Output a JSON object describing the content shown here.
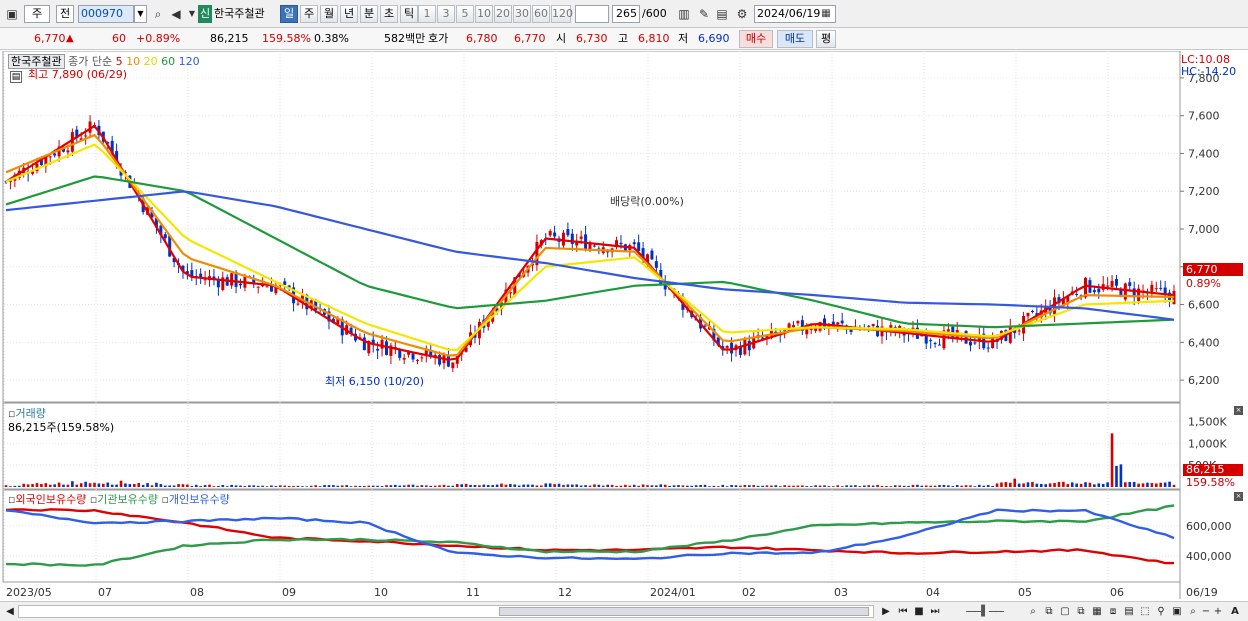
{
  "toolbar": {
    "market": "주",
    "prev_label": "전",
    "code": "000970",
    "stock_name": "한국주철관",
    "new_badge": "신",
    "periods": [
      "일",
      "주",
      "월",
      "년",
      "분",
      "초",
      "틱"
    ],
    "active_period": "일",
    "intervals": [
      "1",
      "3",
      "5",
      "10",
      "20",
      "30",
      "60",
      "120"
    ],
    "count": "265",
    "count_total": "/600",
    "date": "2024/06/19"
  },
  "quote": {
    "price": "6,770",
    "change_arrow": "▲",
    "change": "60",
    "change_pct": "+0.89%",
    "volume": "86,215",
    "volume_ratio": "159.58%",
    "turnover": "0.38%",
    "amount": "582백만",
    "bid_label": "호가",
    "ask": "6,780",
    "bid": "6,770",
    "open_label": "시",
    "open": "6,730",
    "high_label": "고",
    "high": "6,810",
    "low_label": "저",
    "low": "6,690",
    "buy_button": "매수",
    "sell_button": "매도",
    "eval_button": "평"
  },
  "price_panel": {
    "title": "한국주철관",
    "ma_label": "종가 단순",
    "ma_periods": [
      "5",
      "10",
      "20",
      "60",
      "120"
    ],
    "max_label": "최고 7,890 (06/29)",
    "min_label": "최저 6,150 (10/20)",
    "dividend_label": "배당락(0.00%)",
    "lc": "LC:10.08",
    "hc": "HC:-14.20",
    "y_ticks": [
      "7,800",
      "7,600",
      "7,400",
      "7,200",
      "7,000",
      "6,800",
      "6,600",
      "6,400",
      "6,200"
    ],
    "last_price_tag": "6,770",
    "last_pct_tag": "0.89%"
  },
  "volume_panel": {
    "title": "거래량",
    "value_label": "86,215주(159.58%)",
    "y_ticks": [
      "1,500K",
      "1,000K",
      "500K"
    ],
    "last_tag": "86,215",
    "last_pct_tag": "159.58%"
  },
  "holdings_panel": {
    "series_labels": [
      "외국인보유수량",
      "기관보유수량",
      "개인보유수량"
    ],
    "y_ticks": [
      "600,000",
      "400,000"
    ]
  },
  "x_ticks": [
    "2023/05",
    "07",
    "08",
    "09",
    "10",
    "11",
    "12",
    "2024/01",
    "02",
    "03",
    "04",
    "05",
    "06",
    "06/19"
  ],
  "colors": {
    "up": "#d40000",
    "down": "#0030c8",
    "ma5": "#e00000",
    "ma10": "#f08c00",
    "ma20": "#f5e600",
    "ma60": "#1f9a3a",
    "ma120": "#3558e0",
    "foreign": "#e00000",
    "institution": "#2e9a4a",
    "individual": "#2f5fe8"
  },
  "chart_data": [
    {
      "type": "line",
      "title": "한국주철관",
      "ylim": [
        6100,
        7900
      ],
      "x": [
        "2023/05",
        "07",
        "08",
        "09",
        "10",
        "11",
        "12",
        "2024/01",
        "02",
        "03",
        "04",
        "05",
        "06",
        "06/19"
      ],
      "series": [
        {
          "name": "5",
          "values": [
            7250,
            7550,
            6750,
            6700,
            6400,
            6300,
            6950,
            6900,
            6350,
            6500,
            6450,
            6400,
            6700,
            6650
          ]
        },
        {
          "name": "10",
          "values": [
            7300,
            7500,
            6850,
            6700,
            6450,
            6320,
            6900,
            6880,
            6400,
            6480,
            6460,
            6420,
            6650,
            6640
          ]
        },
        {
          "name": "20",
          "values": [
            7250,
            7450,
            6950,
            6720,
            6500,
            6350,
            6800,
            6850,
            6450,
            6480,
            6470,
            6430,
            6600,
            6620
          ]
        },
        {
          "name": "60",
          "values": [
            7130,
            7280,
            7200,
            6950,
            6700,
            6580,
            6620,
            6700,
            6720,
            6620,
            6500,
            6480,
            6500,
            6520
          ]
        },
        {
          "name": "120",
          "values": [
            7100,
            7150,
            7200,
            7120,
            7000,
            6880,
            6820,
            6740,
            6680,
            6650,
            6610,
            6600,
            6580,
            6520
          ]
        }
      ]
    },
    {
      "type": "bar",
      "title": "거래량",
      "ylim": [
        0,
        1600000
      ],
      "x": [
        "2023/05",
        "07",
        "08",
        "09",
        "10",
        "11",
        "12",
        "2024/01",
        "02",
        "03",
        "04",
        "05",
        "06",
        "06/19"
      ],
      "values": [
        40000,
        150000,
        50000,
        35000,
        40000,
        60000,
        70000,
        55000,
        40000,
        35000,
        45000,
        40000,
        1550000,
        86215
      ]
    },
    {
      "type": "line",
      "ylim": [
        250000,
        750000
      ],
      "x": [
        "2023/05",
        "07",
        "08",
        "09",
        "10",
        "11",
        "12",
        "2024/01",
        "02",
        "03",
        "04",
        "05",
        "06",
        "06/19"
      ],
      "series": [
        {
          "name": "외국인보유수량",
          "values": [
            710000,
            700000,
            620000,
            520000,
            500000,
            470000,
            440000,
            440000,
            460000,
            440000,
            420000,
            430000,
            440000,
            350000
          ]
        },
        {
          "name": "기관보유수량",
          "values": [
            350000,
            340000,
            470000,
            510000,
            510000,
            490000,
            430000,
            430000,
            500000,
            600000,
            620000,
            630000,
            630000,
            730000
          ]
        },
        {
          "name": "개인보유수량",
          "values": [
            700000,
            620000,
            630000,
            650000,
            620000,
            420000,
            390000,
            380000,
            420000,
            420000,
            530000,
            700000,
            700000,
            520000
          ]
        }
      ]
    }
  ]
}
